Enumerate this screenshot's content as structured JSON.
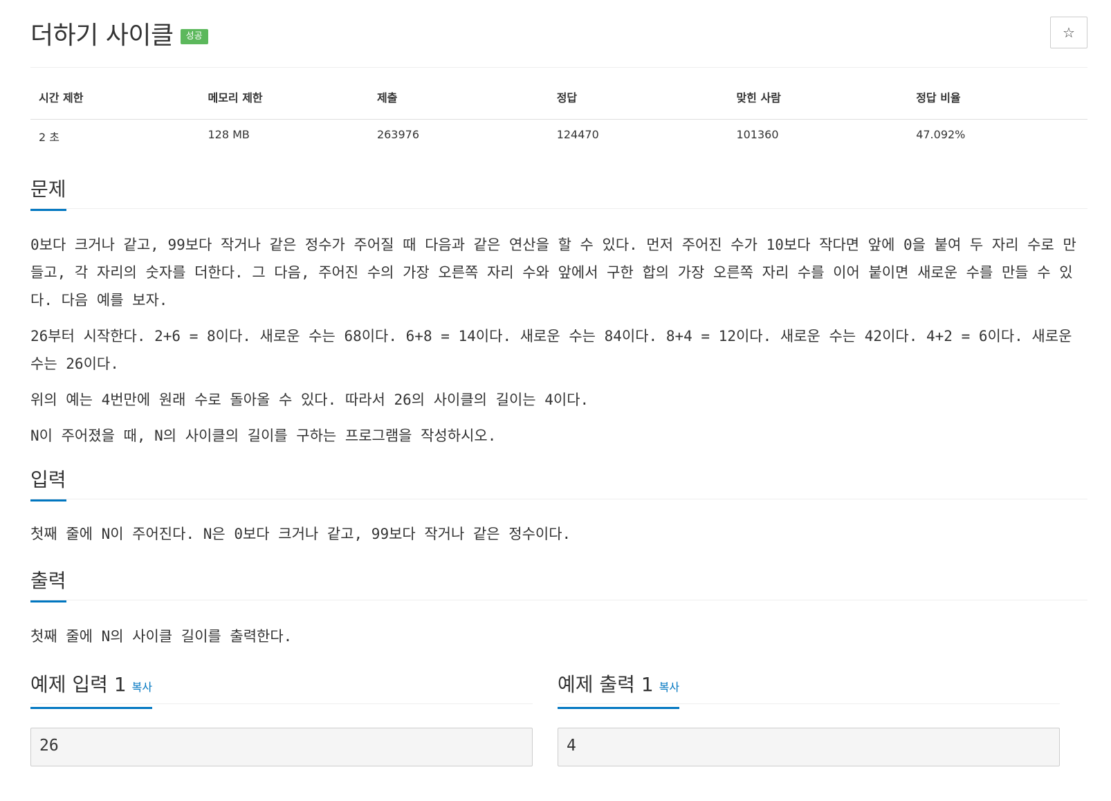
{
  "problem": {
    "title": "더하기 사이클",
    "badge": "성공",
    "star_icon": "☆"
  },
  "info": {
    "headers": [
      "시간 제한",
      "메모리 제한",
      "제출",
      "정답",
      "맞힌 사람",
      "정답 비율"
    ],
    "values": [
      "2 초",
      "128 MB",
      "263976",
      "124470",
      "101360",
      "47.092%"
    ]
  },
  "sections": {
    "description": {
      "title": "문제",
      "paragraphs": [
        "0보다 크거나 같고, 99보다 작거나 같은 정수가 주어질 때 다음과 같은 연산을 할 수 있다. 먼저 주어진 수가 10보다 작다면 앞에 0을 붙여 두 자리 수로 만들고, 각 자리의 숫자를 더한다. 그 다음, 주어진 수의 가장 오른쪽 자리 수와 앞에서 구한 합의 가장 오른쪽 자리 수를 이어 붙이면 새로운 수를 만들 수 있다. 다음 예를 보자.",
        "26부터 시작한다. 2+6 = 8이다. 새로운 수는 68이다. 6+8 = 14이다. 새로운 수는 84이다. 8+4 = 12이다. 새로운 수는 42이다. 4+2 = 6이다. 새로운 수는 26이다.",
        "위의 예는 4번만에 원래 수로 돌아올 수 있다. 따라서 26의 사이클의 길이는 4이다.",
        "N이 주어졌을 때, N의 사이클의 길이를 구하는 프로그램을 작성하시오."
      ]
    },
    "input": {
      "title": "입력",
      "text": "첫째 줄에 N이 주어진다. N은 0보다 크거나 같고, 99보다 작거나 같은 정수이다."
    },
    "output": {
      "title": "출력",
      "text": "첫째 줄에 N의 사이클 길이를 출력한다."
    }
  },
  "samples": {
    "input": {
      "title": "예제 입력 1",
      "copy": "복사",
      "value": "26"
    },
    "output": {
      "title": "예제 출력 1",
      "copy": "복사",
      "value": "4"
    }
  },
  "colors": {
    "accent": "#0076c0",
    "success": "#5cb85c"
  }
}
